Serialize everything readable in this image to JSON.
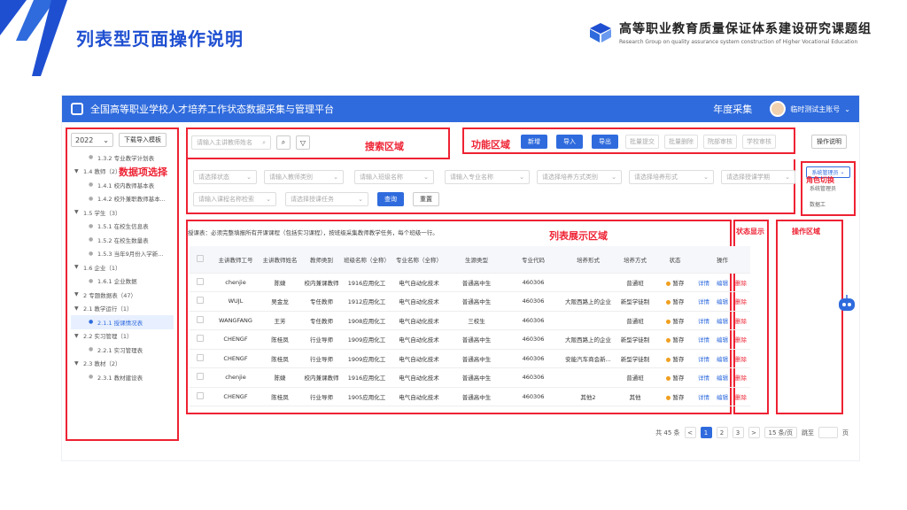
{
  "slide": {
    "title": "列表型页面操作说明",
    "brand_name": "高等职业教育质量保证体系建设研究课题组",
    "brand_sub": "Research Group on quality assurance system construction of Higher Vocational Education",
    "accent": "#1f4fd1"
  },
  "app": {
    "title": "全国高等职业学校人才培养工作状态数据采集与管理平台",
    "annual": "年度采集",
    "user": "临时测试主账号",
    "topbar_color": "#2f6bdd"
  },
  "sidebar": {
    "year": "2022",
    "import_template": "下载导入模板",
    "items": [
      {
        "label": "1.3.2 专业教学计划表",
        "level": 2,
        "type": "leaf"
      },
      {
        "label": "1.4 教师（2）",
        "level": 1,
        "type": "group"
      },
      {
        "label": "1.4.1 校内教师基本表",
        "level": 2,
        "type": "leaf"
      },
      {
        "label": "1.4.2 校外兼职教师基本...",
        "level": 2,
        "type": "leaf"
      },
      {
        "label": "1.5 学生（3）",
        "level": 1,
        "type": "group"
      },
      {
        "label": "1.5.1 在校生信息表",
        "level": 2,
        "type": "leaf"
      },
      {
        "label": "1.5.2 在校生数量表",
        "level": 2,
        "type": "leaf"
      },
      {
        "label": "1.5.3 当年9月份入学新...",
        "level": 2,
        "type": "leaf"
      },
      {
        "label": "1.6 企业（1）",
        "level": 1,
        "type": "group"
      },
      {
        "label": "1.6.1 企业数据",
        "level": 2,
        "type": "leaf"
      },
      {
        "label": "2 专题数据表（47）",
        "level": 0,
        "type": "group"
      },
      {
        "label": "2.1 教学运行（1）",
        "level": 1,
        "type": "group"
      },
      {
        "label": "2.1.1 授课情况表",
        "level": 2,
        "type": "leaf",
        "active": true
      },
      {
        "label": "2.2 实习管理（1）",
        "level": 1,
        "type": "group"
      },
      {
        "label": "2.2.1 实习管理表",
        "level": 2,
        "type": "leaf"
      },
      {
        "label": "2.3 教材（2）",
        "level": 1,
        "type": "group"
      },
      {
        "label": "2.3.1 教材建设表",
        "level": 2,
        "type": "leaf"
      }
    ]
  },
  "search": {
    "main_placeholder": "请输入主讲教师姓名",
    "search_icon": "search-icon",
    "filter_icon": "filter-icon",
    "filters": [
      "请选择状态",
      "请输入教师类别",
      "请输入班级名称",
      "请输入专业名称",
      "请选择培养方式类别",
      "请选择培养形式",
      "请选择授课学期",
      "请输入课程名称检索",
      "请选择授课任务"
    ],
    "query": "查询",
    "reset": "重置"
  },
  "functions": {
    "add": "新增",
    "import": "导入",
    "export": "导出",
    "batch_submit": "批量提交",
    "batch_delete": "批量删除",
    "dept_review": "院部审核",
    "school_review": "学校审核",
    "instructions": "操作说明"
  },
  "role": {
    "current": "系统管理员",
    "options": [
      "系统管理员",
      "数据工"
    ]
  },
  "table": {
    "tip": "授课表：必须完整填报所有开课课程（包括实习课程），按班级采集教师教学任务，每个班级一行。",
    "headers": [
      "主讲教师工号",
      "主讲教师姓名",
      "教师类别",
      "班级名称（全称）",
      "专业名称（全称）",
      "生源类型",
      "专业代码",
      "培养形式",
      "培养方式",
      "状态",
      "操作"
    ],
    "rows": [
      [
        "chenjie",
        "陈婕",
        "校内兼课教师",
        "1916应用化工",
        "电气自动化技术",
        "普通高中生",
        "460306",
        "",
        "普通班",
        "暂存"
      ],
      [
        "WUJL",
        "吴金龙",
        "专任教师",
        "1912应用化工",
        "电气自动化技术",
        "普通高中生",
        "460306",
        "大阪西路上的企业",
        "新型学徒制",
        "暂存"
      ],
      [
        "WANGFANG",
        "王芳",
        "专任教师",
        "1908应用化工",
        "电气自动化技术",
        "三校生",
        "460306",
        "",
        "普通班",
        "暂存"
      ],
      [
        "CHENGF",
        "陈桂凤",
        "行业导师",
        "1909应用化工",
        "电气自动化技术",
        "普通高中生",
        "460306",
        "大阪西路上的企业",
        "新型学徒制",
        "暂存"
      ],
      [
        "CHENGF",
        "陈桂凤",
        "行业导师",
        "1909应用化工",
        "电气自动化技术",
        "普通高中生",
        "460306",
        "安能汽车商会新...",
        "新型学徒制",
        "暂存"
      ],
      [
        "chenjie",
        "陈婕",
        "校内兼课教师",
        "1916应用化工",
        "电气自动化技术",
        "普通高中生",
        "460306",
        "",
        "普通班",
        "暂存"
      ],
      [
        "CHENGF",
        "陈桂凤",
        "行业导师",
        "1905应用化工",
        "电气自动化技术",
        "普通高中生",
        "460306",
        "其他2",
        "其他",
        "暂存"
      ]
    ],
    "ops": [
      "详情",
      "编辑",
      "删除"
    ]
  },
  "pager": {
    "total": "共 45 条",
    "pages": [
      "1",
      "2",
      "3"
    ],
    "current": "1",
    "size": "15 条/页",
    "goto": "跳至",
    "page_unit": "页"
  },
  "annotations": {
    "tree": "数据项选择",
    "search": "搜索区域",
    "func": "功能区域",
    "list": "列表展示区域",
    "status": "状态显示",
    "ops": "操作区域",
    "role": "角色切换",
    "color": "#e22233"
  }
}
